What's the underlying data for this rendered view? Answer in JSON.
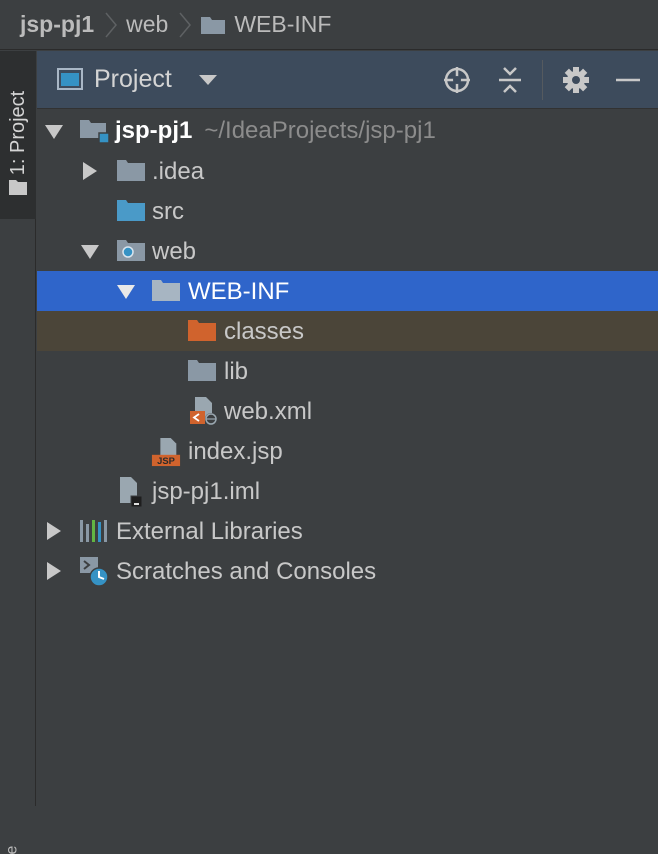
{
  "breadcrumb": {
    "items": [
      "jsp-pj1",
      "web",
      "WEB-INF"
    ]
  },
  "tool_stripe": {
    "project_tab_label": "1: Project",
    "bottom_label": "e"
  },
  "panel": {
    "title": "Project",
    "buttons": [
      "locate-icon",
      "collapse-all-icon",
      "gear-icon",
      "minimize-icon"
    ]
  },
  "tree": {
    "root": {
      "label": "jsp-pj1",
      "path": "~/IdeaProjects/jsp-pj1"
    },
    "idea": {
      "label": ".idea"
    },
    "src": {
      "label": "src"
    },
    "web": {
      "label": "web"
    },
    "webinf": {
      "label": "WEB-INF"
    },
    "classes": {
      "label": "classes"
    },
    "lib": {
      "label": "lib"
    },
    "webxml": {
      "label": "web.xml"
    },
    "indexjsp": {
      "label": "index.jsp",
      "badge": "JSP"
    },
    "iml": {
      "label": "jsp-pj1.iml"
    },
    "extlibs": {
      "label": "External Libraries"
    },
    "scratches": {
      "label": "Scratches and Consoles"
    }
  },
  "colors": {
    "background": "#3c3f41",
    "header": "#3d4b5c",
    "selection": "#2f65ca",
    "hover_row": "#4b4539",
    "folder": "#8a98a5",
    "source_folder": "#4a9ac8",
    "excluded_folder": "#d0632d"
  }
}
